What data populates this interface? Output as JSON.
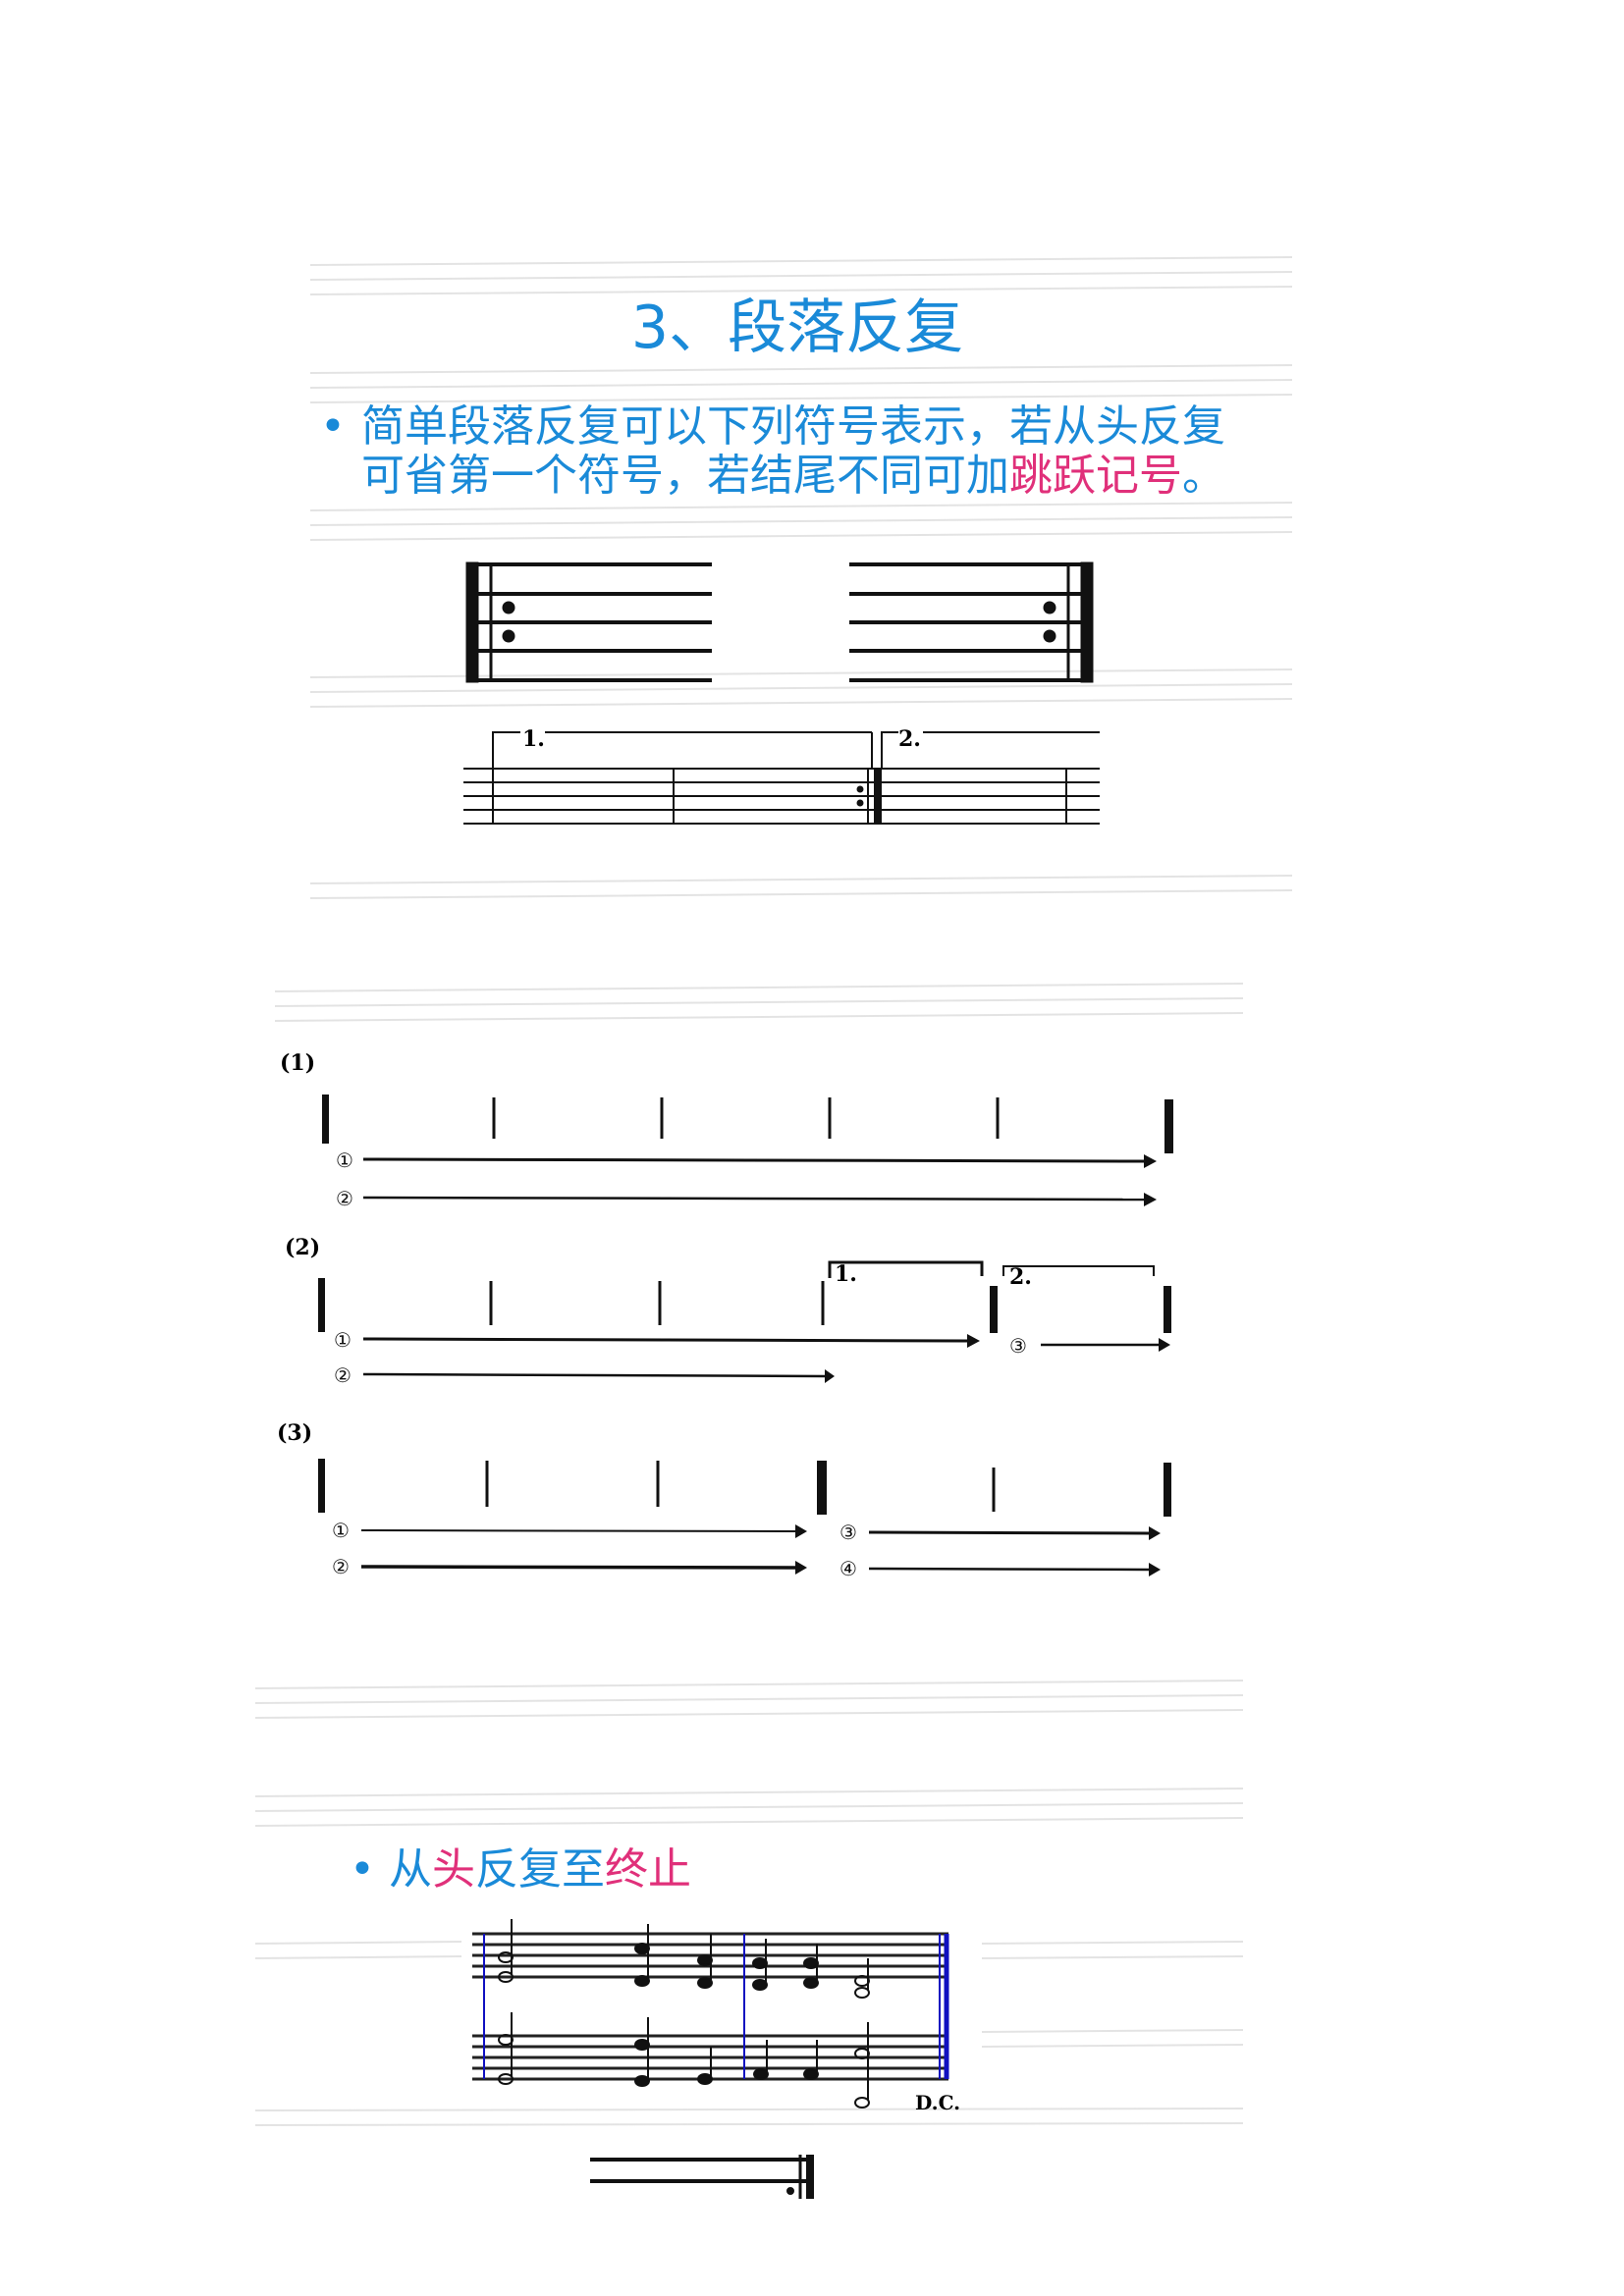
{
  "slide1": {
    "title": "3、段落反复",
    "bullet": {
      "part1": "简单段落反复可以下列符号表示，若从头反复可省第一个符号，若结尾不同可加",
      "part2_highlight": "跳跃记号",
      "part3": "。"
    },
    "volta_labels": [
      "1.",
      "2."
    ]
  },
  "slide2": {
    "labels": [
      "(1)",
      "(2)",
      "(3)"
    ],
    "circled_numbers": [
      "①",
      "②",
      "①",
      "②",
      "③",
      "①",
      "②",
      "③",
      "④"
    ],
    "volta_labels": [
      "1.",
      "2."
    ]
  },
  "slide3": {
    "bullet_segments": [
      {
        "text": "从",
        "color": "blue"
      },
      {
        "text": "头",
        "color": "pink"
      },
      {
        "text": "反复至",
        "color": "blue"
      },
      {
        "text": "终止",
        "color": "pink"
      }
    ],
    "dc_label": "D.C."
  },
  "colors": {
    "accent_blue": "#1a8ad8",
    "highlight_pink": "#e0307a",
    "barline_blue": "#1010c0"
  }
}
